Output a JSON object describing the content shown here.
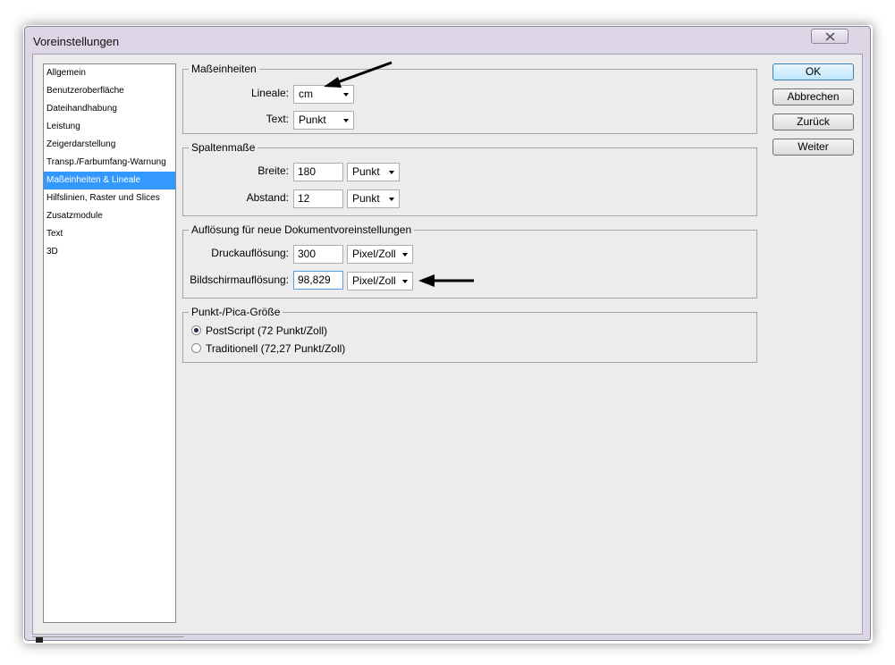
{
  "window": {
    "title": "Voreinstellungen"
  },
  "sidebar": {
    "items": [
      {
        "label": "Allgemein"
      },
      {
        "label": "Benutzeroberfläche"
      },
      {
        "label": "Dateihandhabung"
      },
      {
        "label": "Leistung"
      },
      {
        "label": "Zeigerdarstellung"
      },
      {
        "label": "Transp./Farbumfang-Warnung"
      },
      {
        "label": "Maßeinheiten & Lineale",
        "selected": true
      },
      {
        "label": "Hilfslinien, Raster und Slices"
      },
      {
        "label": "Zusatzmodule"
      },
      {
        "label": "Text"
      },
      {
        "label": "3D"
      }
    ]
  },
  "units": {
    "title": "Maßeinheiten",
    "rulers_label": "Lineale:",
    "rulers_value": "cm",
    "type_label": "Text:",
    "type_value": "Punkt"
  },
  "columns": {
    "title": "Spaltenmaße",
    "width_label": "Breite:",
    "width_value": "180",
    "width_unit": "Punkt",
    "gutter_label": "Abstand:",
    "gutter_value": "12",
    "gutter_unit": "Punkt"
  },
  "resolution": {
    "title": "Auflösung für neue Dokumentvoreinstellungen",
    "print_label": "Druckauflösung:",
    "print_value": "300",
    "print_unit": "Pixel/Zoll",
    "screen_label": "Bildschirmauflösung:",
    "screen_value": "98,829",
    "screen_unit": "Pixel/Zoll"
  },
  "point_size": {
    "title": "Punkt-/Pica-Größe",
    "options": [
      {
        "label": "PostScript (72 Punkt/Zoll)",
        "checked": true
      },
      {
        "label": "Traditionell (72,27 Punkt/Zoll)",
        "checked": false
      }
    ]
  },
  "buttons": {
    "ok": "OK",
    "cancel": "Abbrechen",
    "reset": "Zurück",
    "next": "Weiter"
  },
  "icons": {
    "close": "close-icon",
    "annotation": "arrow-icon"
  }
}
